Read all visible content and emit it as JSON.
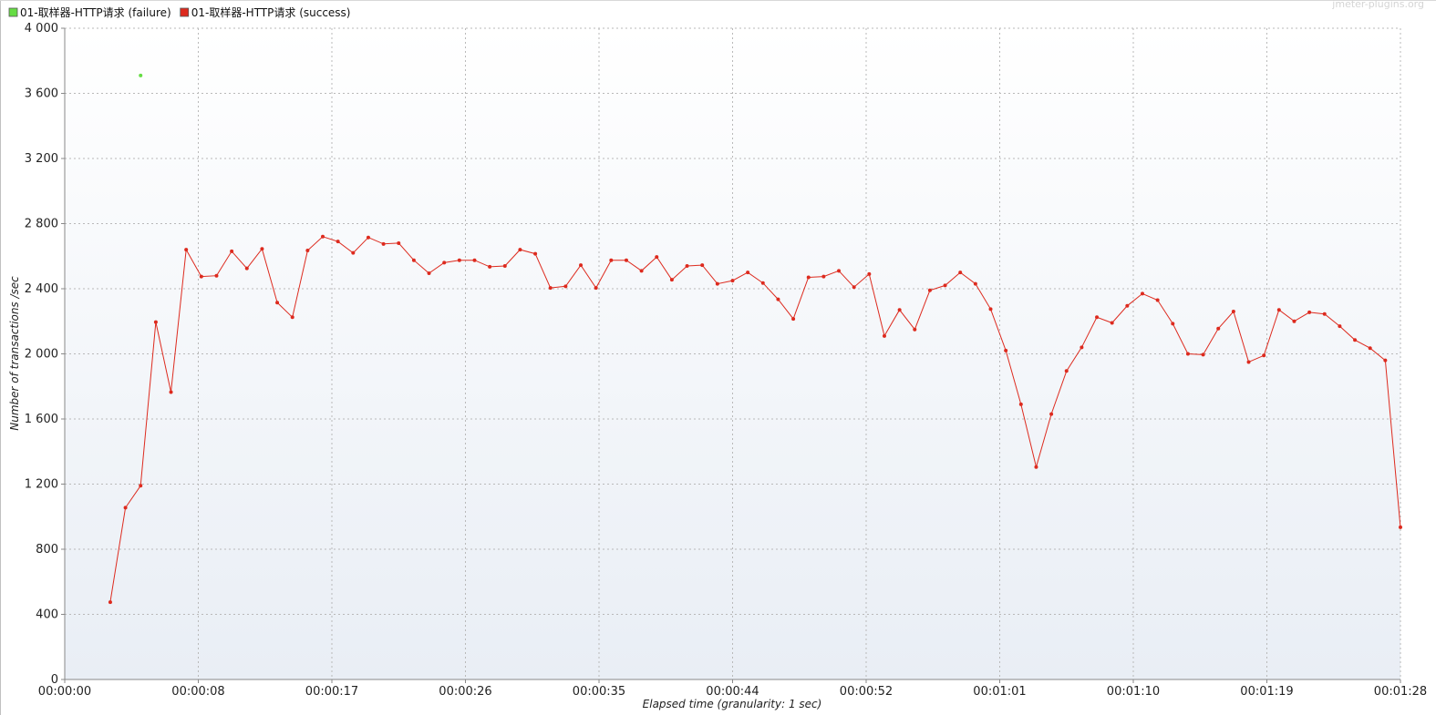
{
  "watermark": "jmeter-plugins.org",
  "chart_data": {
    "type": "line",
    "title": "",
    "xlabel": "Elapsed time (granularity: 1 sec)",
    "ylabel": "Number of transactions /sec",
    "ylim": [
      0,
      4000
    ],
    "xlim": [
      "00:00:00",
      "00:01:28"
    ],
    "y_ticks": [
      0,
      400,
      800,
      1200,
      1600,
      2000,
      2400,
      2800,
      3200,
      3600,
      4000
    ],
    "y_tick_labels": [
      "0",
      "400",
      "800",
      "1 200",
      "1 600",
      "2 000",
      "2 400",
      "2 800",
      "3 200",
      "3 600",
      "4 000"
    ],
    "x_tick_labels": [
      "00:00:00",
      "00:00:08",
      "00:00:17",
      "00:00:26",
      "00:00:35",
      "00:00:44",
      "00:00:52",
      "00:01:01",
      "00:01:10",
      "00:01:19",
      "00:01:28"
    ],
    "grid": true,
    "legend_position": "top-left",
    "background_gradient": [
      "#ffffff",
      "#e9eef5"
    ],
    "series": [
      {
        "name": "01-取样器-HTTP请求 (failure)",
        "color": "#66dd44",
        "x": [
          5
        ],
        "values": [
          3710
        ]
      },
      {
        "name": "01-取样器-HTTP请求 (success)",
        "color": "#dd2a1e",
        "x": [
          3,
          4,
          5,
          6,
          7,
          8,
          9,
          10,
          11,
          12,
          13,
          14,
          15,
          16,
          17,
          18,
          19,
          20,
          21,
          22,
          23,
          24,
          25,
          26,
          27,
          28,
          29,
          30,
          31,
          32,
          33,
          34,
          35,
          36,
          37,
          38,
          39,
          40,
          41,
          42,
          43,
          44,
          45,
          46,
          47,
          48,
          49,
          50,
          51,
          52,
          53,
          54,
          55,
          56,
          57,
          58,
          59,
          60,
          61,
          62,
          63,
          64,
          65,
          66,
          67,
          68,
          69,
          70,
          71,
          72,
          73,
          74,
          75,
          76,
          77,
          78,
          79,
          80,
          81,
          82,
          83,
          84,
          85,
          86,
          87,
          88
        ],
        "values": [
          475,
          1055,
          1190,
          2195,
          1765,
          2640,
          2475,
          2480,
          2630,
          2525,
          2645,
          2315,
          2225,
          2635,
          2720,
          2690,
          2620,
          2715,
          2675,
          2680,
          2575,
          2495,
          2560,
          2575,
          2575,
          2535,
          2540,
          2640,
          2615,
          2405,
          2415,
          2545,
          2405,
          2575,
          2575,
          2510,
          2595,
          2455,
          2540,
          2545,
          2430,
          2450,
          2500,
          2435,
          2335,
          2215,
          2470,
          2475,
          2510,
          2410,
          2490,
          2110,
          2270,
          2150,
          2390,
          2420,
          2500,
          2430,
          2275,
          2020,
          1690,
          1305,
          1630,
          1895,
          2040,
          2225,
          2190,
          2295,
          2370,
          2330,
          2185,
          2000,
          1995,
          2155,
          2260,
          1950,
          1990,
          2270,
          2200,
          2255,
          2245,
          2170,
          2085,
          2035,
          1960,
          935
        ]
      }
    ]
  }
}
